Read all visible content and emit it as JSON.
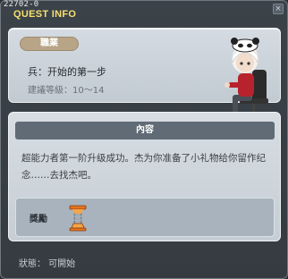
{
  "window": {
    "id_text": "22702-0",
    "title": "QUEST INFO",
    "close_glyph": "×"
  },
  "info": {
    "category": "職業",
    "quest_name": "兵：开始的第一步",
    "level_requirement": "建議等級：10～14"
  },
  "content": {
    "header": "內容",
    "description": "超能力者第一阶升级成功。杰为你准备了小礼物给你留作纪念……去找杰吧。",
    "reward_label": "獎勵",
    "reward_item_icon": "spring-trophy-icon"
  },
  "status": {
    "text": "狀態： 可開始"
  },
  "colors": {
    "title_yellow": "#f6e06e",
    "badge_tan": "#b8a486",
    "header_slate": "#606b76",
    "window_bg": "#3b4249"
  }
}
